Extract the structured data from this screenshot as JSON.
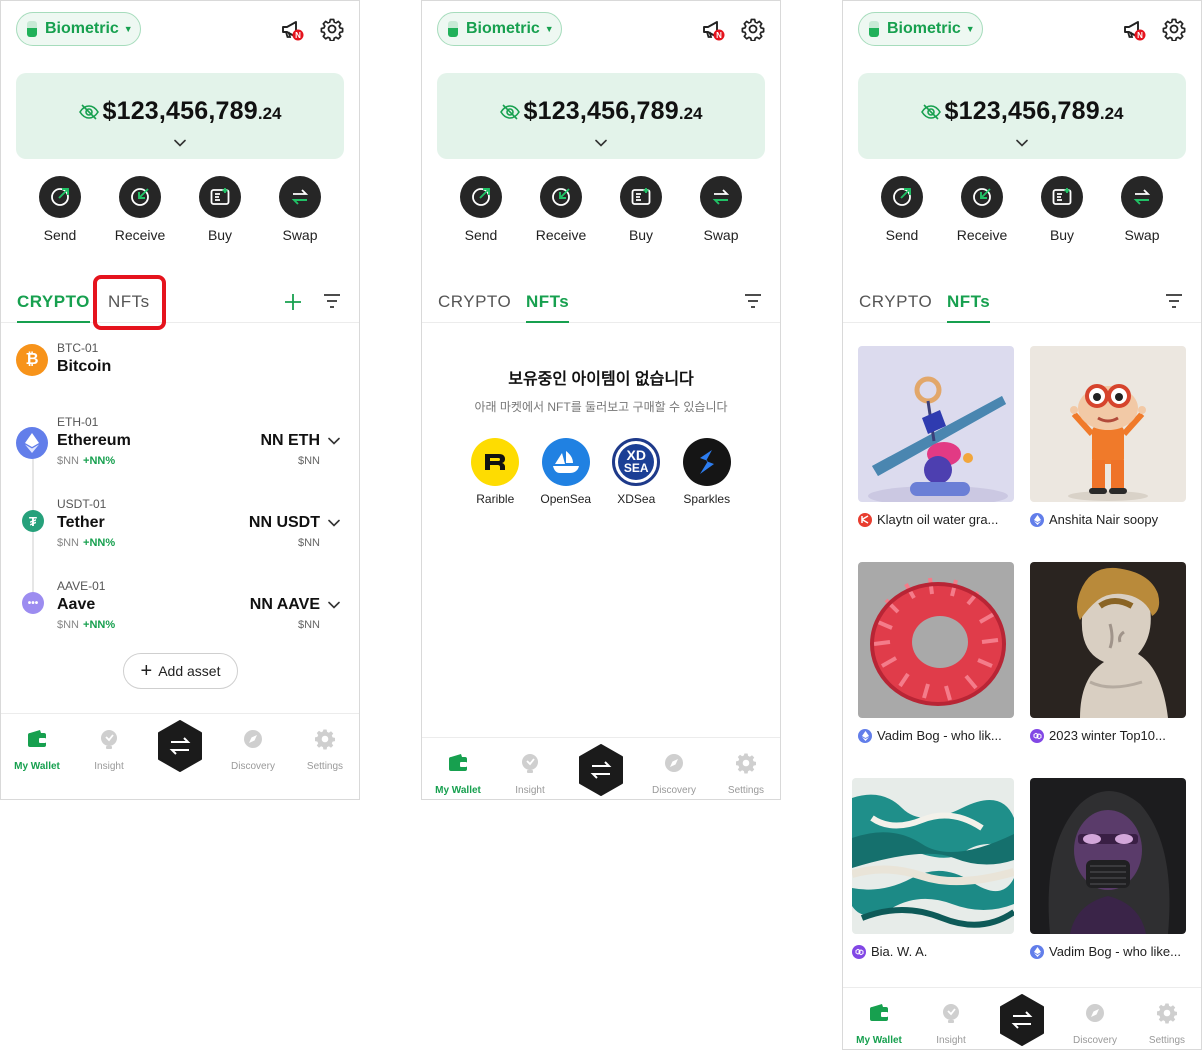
{
  "common": {
    "biometric_label": "Biometric",
    "notice_badge": "N",
    "balance_main": "$123,456,789",
    "balance_decimals": ".24",
    "actions": [
      {
        "label": "Send",
        "icon": "send-icon"
      },
      {
        "label": "Receive",
        "icon": "receive-icon"
      },
      {
        "label": "Buy",
        "icon": "buy-icon"
      },
      {
        "label": "Swap",
        "icon": "swap-icon"
      }
    ],
    "tabs": {
      "crypto": "CRYPTO",
      "nfts": "NFTs"
    },
    "nav": {
      "wallet": "My Wallet",
      "insight": "Insight",
      "discovery": "Discovery",
      "settings": "Settings"
    },
    "colors": {
      "accent": "#17a04f",
      "highlight": "#e5131d",
      "card": "#e3f3ea",
      "dark": "#262626"
    }
  },
  "crypto_screen": {
    "assets": [
      {
        "code": "BTC-01",
        "name": "Bitcoin",
        "icon": "bitcoin-icon",
        "sub": "",
        "change": "",
        "amount": "",
        "fiat": ""
      },
      {
        "code": "ETH-01",
        "name": "Ethereum",
        "icon": "ethereum-icon",
        "sub": "$NN",
        "change": "+NN%",
        "amount": "NN ETH",
        "fiat": "$NN"
      },
      {
        "code": "USDT-01",
        "name": "Tether",
        "icon": "tether-icon",
        "sub": "$NN",
        "change": "+NN%",
        "amount": "NN USDT",
        "fiat": "$NN"
      },
      {
        "code": "AAVE-01",
        "name": "Aave",
        "icon": "aave-icon",
        "sub": "$NN",
        "change": "+NN%",
        "amount": "NN AAVE",
        "fiat": "$NN"
      }
    ],
    "add_asset_label": "Add asset"
  },
  "empty_nft_screen": {
    "title": "보유중인 아이템이 없습니다",
    "subtitle": "아래 마켓에서 NFT를 둘러보고 구매할 수 있습니다",
    "markets": [
      {
        "label": "Rarible",
        "icon": "rarible-icon"
      },
      {
        "label": "OpenSea",
        "icon": "opensea-icon"
      },
      {
        "label": "XDSea",
        "icon": "xdsea-icon"
      },
      {
        "label": "Sparkles",
        "icon": "sparkles-icon"
      }
    ],
    "xdsea_logo_text": [
      "XD",
      "SEA"
    ]
  },
  "nft_screen": {
    "items": [
      {
        "caption": "Klaytn oil water gra...",
        "chain": "klaytn-icon"
      },
      {
        "caption": "Anshita Nair soopy",
        "chain": "ethereum-icon"
      },
      {
        "caption": "Vadim Bog - who lik...",
        "chain": "ethereum-icon"
      },
      {
        "caption": "2023 winter Top10...",
        "chain": "polygon-icon"
      },
      {
        "caption": "Bia. W. A.",
        "chain": "polygon-icon"
      },
      {
        "caption": "Vadim Bog - who like...",
        "chain": "ethereum-icon"
      }
    ]
  }
}
